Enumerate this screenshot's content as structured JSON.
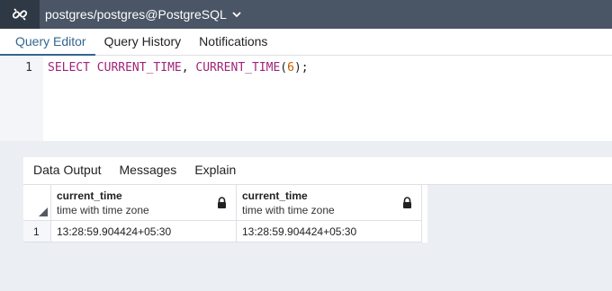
{
  "connection": {
    "title": "postgres/postgres@PostgreSQL",
    "icon": "connection-icon",
    "dropdown_icon": "chevron-down-icon"
  },
  "tabs": [
    {
      "label": "Query Editor",
      "active": true
    },
    {
      "label": "Query History",
      "active": false
    },
    {
      "label": "Notifications",
      "active": false
    }
  ],
  "editor": {
    "line_number": "1",
    "code": {
      "kw1": "SELECT",
      "sp1": " ",
      "kw2": "CURRENT_TIME",
      "p1": ", ",
      "kw3": "CURRENT_TIME",
      "p2": "(",
      "num": "6",
      "p3": ");"
    }
  },
  "results": {
    "tabs": [
      "Data Output",
      "Messages",
      "Explain"
    ],
    "columns": [
      {
        "name": "current_time",
        "type": "time with time zone",
        "icon": "lock-icon"
      },
      {
        "name": "current_time",
        "type": "time with time zone",
        "icon": "lock-icon"
      }
    ],
    "rows": [
      {
        "num": "1",
        "cells": [
          "13:28:59.904424+05:30",
          "13:28:59.904424+05:30"
        ]
      }
    ]
  },
  "colors": {
    "topbar": "#4a5565",
    "accent": "#326690",
    "keyword": "#a0237a",
    "number": "#c45a00"
  }
}
